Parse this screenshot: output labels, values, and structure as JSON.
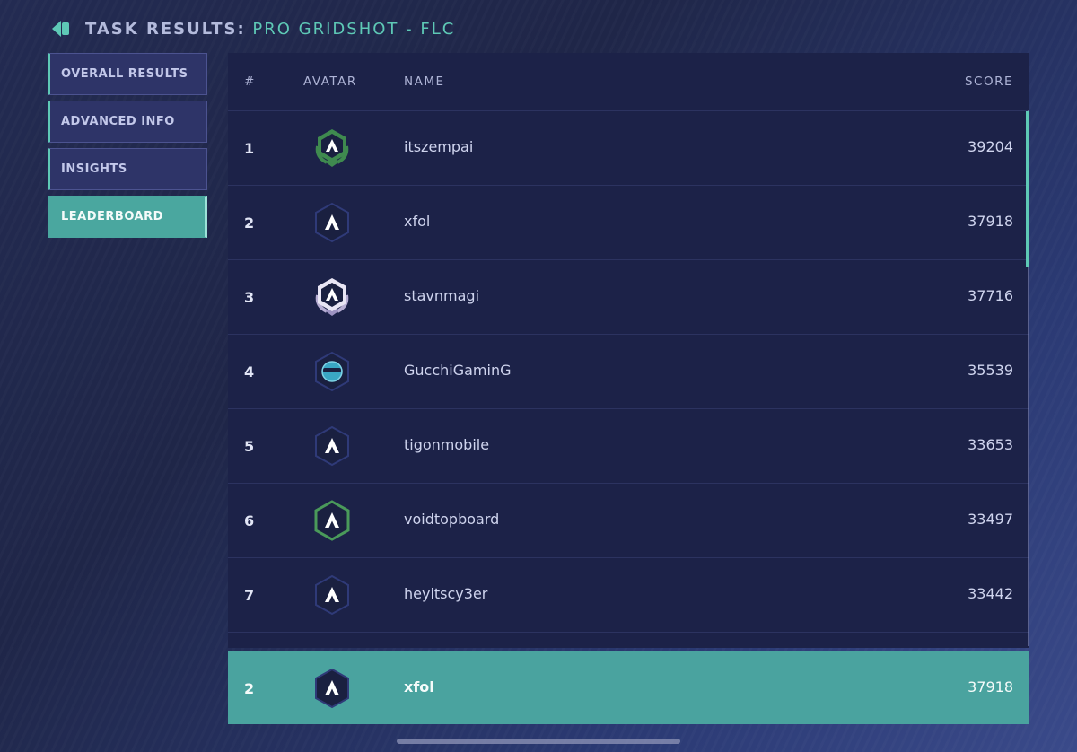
{
  "header": {
    "title_label": "TASK RESULTS:",
    "task_name": "PRO GRIDSHOT - FLC"
  },
  "nav": {
    "items": [
      {
        "label": "OVERALL RESULTS"
      },
      {
        "label": "ADVANCED INFO"
      },
      {
        "label": "INSIGHTS"
      },
      {
        "label": "LEADERBOARD"
      }
    ],
    "active": "LEADERBOARD"
  },
  "leaderboard": {
    "columns": {
      "rank": "#",
      "avatar": "AVATAR",
      "name": "NAME",
      "score": "SCORE"
    },
    "rows": [
      {
        "rank": "1",
        "name": "itszempai",
        "score": "39204",
        "avatar": "gold-laurel-badge-icon"
      },
      {
        "rank": "2",
        "name": "xfol",
        "score": "37918",
        "avatar": "hexagon-badge-icon"
      },
      {
        "rank": "3",
        "name": "stavnmagi",
        "score": "37716",
        "avatar": "silver-laurel-badge-icon"
      },
      {
        "rank": "4",
        "name": "GucchiGaminG",
        "score": "35539",
        "avatar": "custom-avatar-icon"
      },
      {
        "rank": "5",
        "name": "tigonmobile",
        "score": "33653",
        "avatar": "hexagon-badge-icon"
      },
      {
        "rank": "6",
        "name": "voidtopboard",
        "score": "33497",
        "avatar": "green-hexagon-badge-icon"
      },
      {
        "rank": "7",
        "name": "heyitscy3er",
        "score": "33442",
        "avatar": "hexagon-badge-icon"
      }
    ],
    "current_user": {
      "rank": "2",
      "name": "xfol",
      "score": "37918",
      "avatar": "hexagon-badge-icon"
    }
  },
  "colors": {
    "accent": "#5ec9b6",
    "active_nav": "#4aa79f",
    "highlight_row": "#4aa39f",
    "panel": "#1c2248"
  }
}
